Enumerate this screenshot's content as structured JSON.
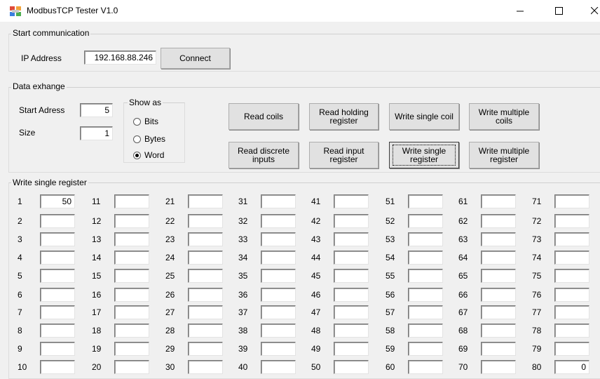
{
  "window": {
    "title": "ModbusTCP Tester V1.0",
    "minimize_glyph": "–",
    "maximize_glyph": "☐",
    "close_glyph": "✕"
  },
  "start_communication": {
    "title": "Start communication",
    "ip_label": "IP Address",
    "ip_value": "192.168.88.246",
    "connect_label": "Connect"
  },
  "data_exchange": {
    "title": "Data exhange",
    "start_address_label": "Start Adress",
    "start_address_value": "5",
    "size_label": "Size",
    "size_value": "1",
    "show_as": {
      "title": "Show as",
      "options": [
        "Bits",
        "Bytes",
        "Word"
      ],
      "selected": "Word"
    },
    "buttons": {
      "read_coils": "Read coils",
      "read_holding_register": "Read holding\nregister",
      "write_single_coil": "Write single coil",
      "write_multiple_coils": "Write multiple\ncoils",
      "read_discrete_inputs": "Read discrete\ninputs",
      "read_input_register": "Read input\nregister",
      "write_single_register": "Write single\nregister",
      "write_multiple_register": "Write multiple\nregister"
    }
  },
  "write_single_register": {
    "title": "Write single register",
    "registers": [
      {
        "n": "1",
        "v": "50"
      },
      {
        "n": "2",
        "v": ""
      },
      {
        "n": "3",
        "v": ""
      },
      {
        "n": "4",
        "v": ""
      },
      {
        "n": "5",
        "v": ""
      },
      {
        "n": "6",
        "v": ""
      },
      {
        "n": "7",
        "v": ""
      },
      {
        "n": "8",
        "v": ""
      },
      {
        "n": "9",
        "v": ""
      },
      {
        "n": "10",
        "v": ""
      },
      {
        "n": "11",
        "v": ""
      },
      {
        "n": "12",
        "v": ""
      },
      {
        "n": "13",
        "v": ""
      },
      {
        "n": "14",
        "v": ""
      },
      {
        "n": "15",
        "v": ""
      },
      {
        "n": "16",
        "v": ""
      },
      {
        "n": "17",
        "v": ""
      },
      {
        "n": "18",
        "v": ""
      },
      {
        "n": "19",
        "v": ""
      },
      {
        "n": "20",
        "v": ""
      },
      {
        "n": "21",
        "v": ""
      },
      {
        "n": "22",
        "v": ""
      },
      {
        "n": "23",
        "v": ""
      },
      {
        "n": "24",
        "v": ""
      },
      {
        "n": "25",
        "v": ""
      },
      {
        "n": "26",
        "v": ""
      },
      {
        "n": "27",
        "v": ""
      },
      {
        "n": "28",
        "v": ""
      },
      {
        "n": "29",
        "v": ""
      },
      {
        "n": "30",
        "v": ""
      },
      {
        "n": "31",
        "v": ""
      },
      {
        "n": "32",
        "v": ""
      },
      {
        "n": "33",
        "v": ""
      },
      {
        "n": "34",
        "v": ""
      },
      {
        "n": "35",
        "v": ""
      },
      {
        "n": "36",
        "v": ""
      },
      {
        "n": "37",
        "v": ""
      },
      {
        "n": "38",
        "v": ""
      },
      {
        "n": "39",
        "v": ""
      },
      {
        "n": "40",
        "v": ""
      },
      {
        "n": "41",
        "v": ""
      },
      {
        "n": "42",
        "v": ""
      },
      {
        "n": "43",
        "v": ""
      },
      {
        "n": "44",
        "v": ""
      },
      {
        "n": "45",
        "v": ""
      },
      {
        "n": "46",
        "v": ""
      },
      {
        "n": "47",
        "v": ""
      },
      {
        "n": "48",
        "v": ""
      },
      {
        "n": "49",
        "v": ""
      },
      {
        "n": "50",
        "v": ""
      },
      {
        "n": "51",
        "v": ""
      },
      {
        "n": "52",
        "v": ""
      },
      {
        "n": "53",
        "v": ""
      },
      {
        "n": "54",
        "v": ""
      },
      {
        "n": "55",
        "v": ""
      },
      {
        "n": "56",
        "v": ""
      },
      {
        "n": "57",
        "v": ""
      },
      {
        "n": "58",
        "v": ""
      },
      {
        "n": "59",
        "v": ""
      },
      {
        "n": "60",
        "v": ""
      },
      {
        "n": "61",
        "v": ""
      },
      {
        "n": "62",
        "v": ""
      },
      {
        "n": "63",
        "v": ""
      },
      {
        "n": "64",
        "v": ""
      },
      {
        "n": "65",
        "v": ""
      },
      {
        "n": "66",
        "v": ""
      },
      {
        "n": "67",
        "v": ""
      },
      {
        "n": "68",
        "v": ""
      },
      {
        "n": "69",
        "v": ""
      },
      {
        "n": "70",
        "v": ""
      },
      {
        "n": "71",
        "v": ""
      },
      {
        "n": "72",
        "v": ""
      },
      {
        "n": "73",
        "v": ""
      },
      {
        "n": "74",
        "v": ""
      },
      {
        "n": "75",
        "v": ""
      },
      {
        "n": "76",
        "v": ""
      },
      {
        "n": "77",
        "v": ""
      },
      {
        "n": "78",
        "v": ""
      },
      {
        "n": "79",
        "v": ""
      },
      {
        "n": "80",
        "v": "0"
      }
    ]
  }
}
